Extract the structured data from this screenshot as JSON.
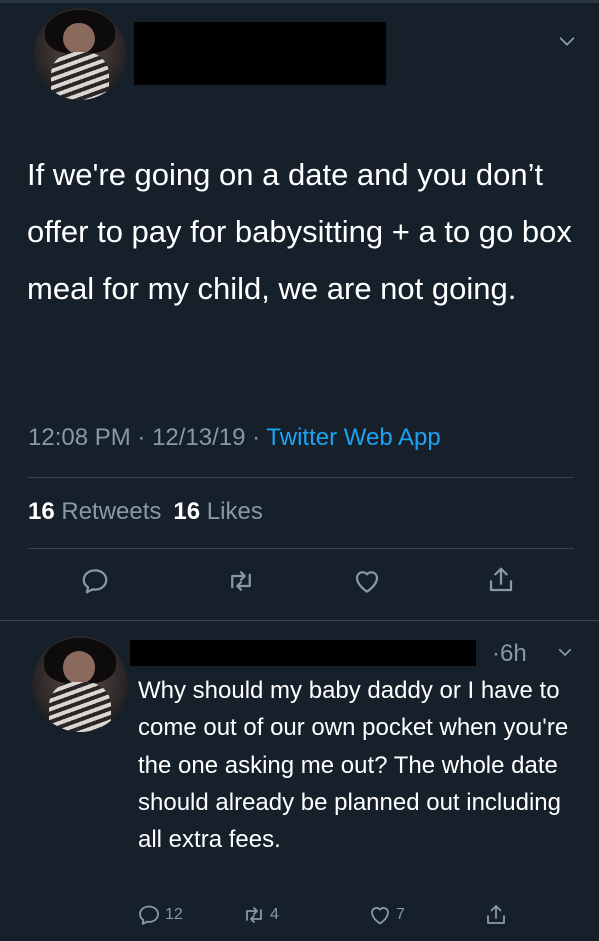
{
  "tweet": {
    "text": "If we're going on a date and you don’t offer to pay for babysitting + a to go box meal for my child, we are not going.",
    "time": "12:08 PM",
    "date": "12/13/19",
    "source": "Twitter Web App",
    "retweets_count": "16",
    "retweets_label": "Retweets",
    "likes_count": "16",
    "likes_label": "Likes",
    "icons": [
      "reply-icon",
      "retweet-icon",
      "like-icon",
      "share-icon"
    ]
  },
  "reply": {
    "age": "·6h",
    "text": "Why should my baby daddy or I have to come out of our own pocket when you're the one asking me out? The whole date should already be planned out including all extra fees.",
    "replies": "12",
    "retweets": "4",
    "likes": "7"
  },
  "colors": {
    "background": "#15202b",
    "secondary_text": "#8899a6",
    "accent": "#1da1f2",
    "divider": "#38444d"
  }
}
